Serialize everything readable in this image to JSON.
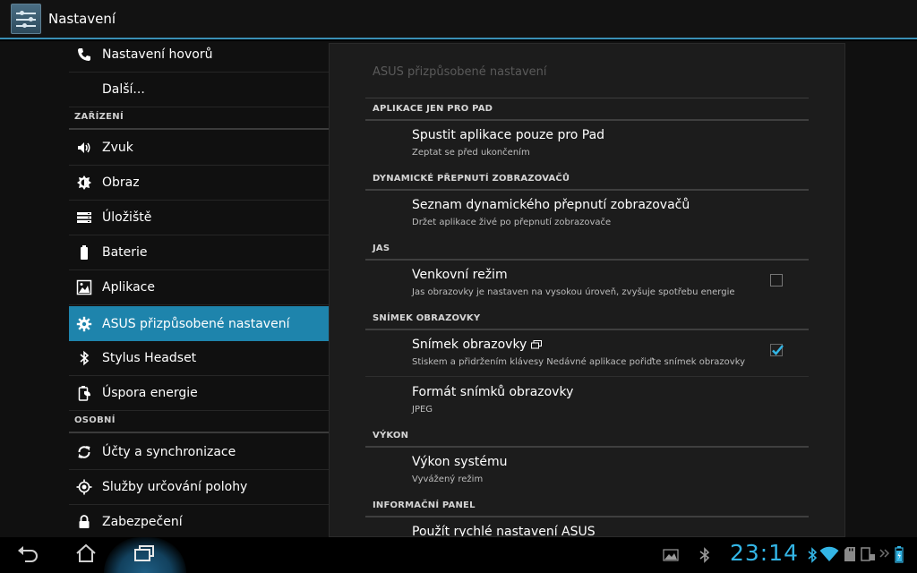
{
  "app": {
    "title": "Nastavení"
  },
  "sidebar": {
    "items": [
      {
        "label": "Nastavení hovorů",
        "icon": "phone-icon"
      },
      {
        "label": "Další...",
        "icon": ""
      },
      {
        "section": "ZAŘÍZENÍ"
      },
      {
        "label": "Zvuk",
        "icon": "sound-icon"
      },
      {
        "label": "Obraz",
        "icon": "brightness-icon"
      },
      {
        "label": "Úložiště",
        "icon": "storage-icon"
      },
      {
        "label": "Baterie",
        "icon": "battery-icon"
      },
      {
        "label": "Aplikace",
        "icon": "apps-icon"
      },
      {
        "label": "ASUS přizpůsobené nastavení",
        "icon": "gear-icon",
        "selected": true
      },
      {
        "label": "Stylus Headset",
        "icon": "bluetooth-icon"
      },
      {
        "label": "Úspora energie",
        "icon": "power-saving-icon"
      },
      {
        "section": "OSOBNÍ"
      },
      {
        "label": "Účty a synchronizace",
        "icon": "sync-icon"
      },
      {
        "label": "Služby určování polohy",
        "icon": "location-icon"
      },
      {
        "label": "Zabezpečení",
        "icon": "lock-icon"
      }
    ]
  },
  "panel": {
    "title": "ASUS přizpůsobené nastavení",
    "categories": [
      {
        "title": "APLIKACE JEN PRO PAD"
      },
      {
        "title": "DYNAMICKÉ PŘEPNUTÍ ZOBRAZOVAČŮ"
      },
      {
        "title": "JAS"
      },
      {
        "title": "SNÍMEK OBRAZOVKY"
      },
      {
        "title": "VÝKON"
      },
      {
        "title": "INFORMAČNÍ PANEL"
      }
    ],
    "prefs": [
      {
        "title": "Spustit aplikace pouze pro Pad",
        "summary": "Zeptat se před ukončením"
      },
      {
        "title": "Seznam dynamického přepnutí zobrazovačů",
        "summary": "Držet aplikace živé po přepnutí zobrazovače"
      },
      {
        "title": "Venkovní režim",
        "summary": "Jas obrazovky je nastaven na vysokou úroveň, zvyšuje spotřebu energie",
        "checked": false
      },
      {
        "title": "Snímek obrazovky",
        "summary": "Stiskem a přidržením klávesy Nedávné aplikace pořiďte snímek obrazovky",
        "checked": true
      },
      {
        "title": "Formát snímků obrazovky",
        "summary": "JPEG"
      },
      {
        "title": "Výkon systému",
        "summary": "Vyvážený režim"
      },
      {
        "title": "Použít rychlé nastavení ASUS",
        "summary": ""
      }
    ]
  },
  "statusbar": {
    "clock": "23:14",
    "accent": "#33b5e5"
  },
  "colors": {
    "accent": "#33b5e5",
    "selected": "#1e84ac",
    "panel": "#1c1c1c"
  }
}
